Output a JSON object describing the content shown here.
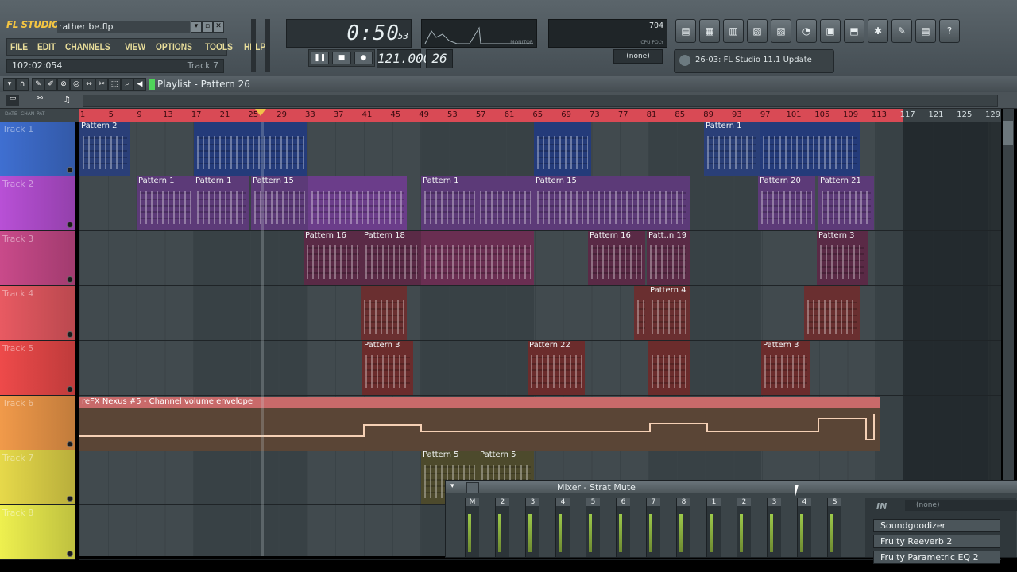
{
  "app": {
    "logo": "FL STUDIO",
    "project_name": "rather be.flp"
  },
  "menu": [
    "FILE",
    "EDIT",
    "CHANNELS",
    "VIEW",
    "OPTIONS",
    "TOOLS",
    "HELP"
  ],
  "hint": {
    "position": "102:02:054",
    "track": "Track 7"
  },
  "transport": {
    "time": "0:50",
    "time_sub": "53",
    "tempo": "121.000",
    "pattern": "26",
    "snap": "(none)"
  },
  "cpu": {
    "value": "704",
    "label": "CPU POLY"
  },
  "osc_label": "MONITOR",
  "news": "26-03: FL Studio 11.1 Update",
  "playlist": {
    "title": "Playlist - Pattern 26"
  },
  "ruler": {
    "red": [
      "1",
      "5",
      "9",
      "13",
      "17",
      "21",
      "25",
      "29",
      "33",
      "37",
      "41",
      "45",
      "49",
      "53",
      "57",
      "61",
      "65",
      "69",
      "73",
      "77",
      "81",
      "85",
      "89",
      "93",
      "97",
      "101",
      "105",
      "109",
      "113"
    ],
    "gray": [
      "117",
      "121",
      "125",
      "129"
    ]
  },
  "ruler_head": [
    "DATE",
    "CHAN",
    "PAT"
  ],
  "tracks": [
    {
      "name": "Track 1",
      "color": "#3f6fd1"
    },
    {
      "name": "Track 2",
      "color": "#b850d6"
    },
    {
      "name": "Track 3",
      "color": "#c94a8a"
    },
    {
      "name": "Track 4",
      "color": "#e85a62"
    },
    {
      "name": "Track 5",
      "color": "#ee4a4a"
    },
    {
      "name": "Track 6",
      "color": "#f19a4a"
    },
    {
      "name": "Track 7",
      "color": "#e6d94a"
    },
    {
      "name": "Track 8",
      "color": "#eef04f"
    }
  ],
  "clips": {
    "t1": [
      "Pattern 2",
      "Pattern 1"
    ],
    "t2": [
      "Pattern 1",
      "Pattern 1",
      "Pattern 15",
      "Pattern 1",
      "Pattern 15",
      "Pattern 20",
      "Pattern 21"
    ],
    "t3": [
      "Pattern 16",
      "Pattern 18",
      "Pattern 16",
      "Patt..n 19",
      "Pattern 3"
    ],
    "t4": [
      "Pattern 4"
    ],
    "t5": [
      "Pattern 3",
      "Pattern 22",
      "Pattern 3"
    ],
    "t6": "reFX Nexus #5 - Channel volume envelope",
    "t7": [
      "Pattern 5",
      "Pattern 5"
    ]
  },
  "mixer": {
    "title": "Mixer - Strat Mute",
    "strips": [
      "M",
      "2",
      "3",
      "4",
      "5",
      "6",
      "7",
      "8",
      "1",
      "2",
      "3",
      "4",
      "S"
    ],
    "fx": [
      "Soundgoodizer",
      "Fruity Reeverb 2",
      "Fruity Parametric EQ 2"
    ],
    "in_label": "IN",
    "in_value": "(none)"
  }
}
